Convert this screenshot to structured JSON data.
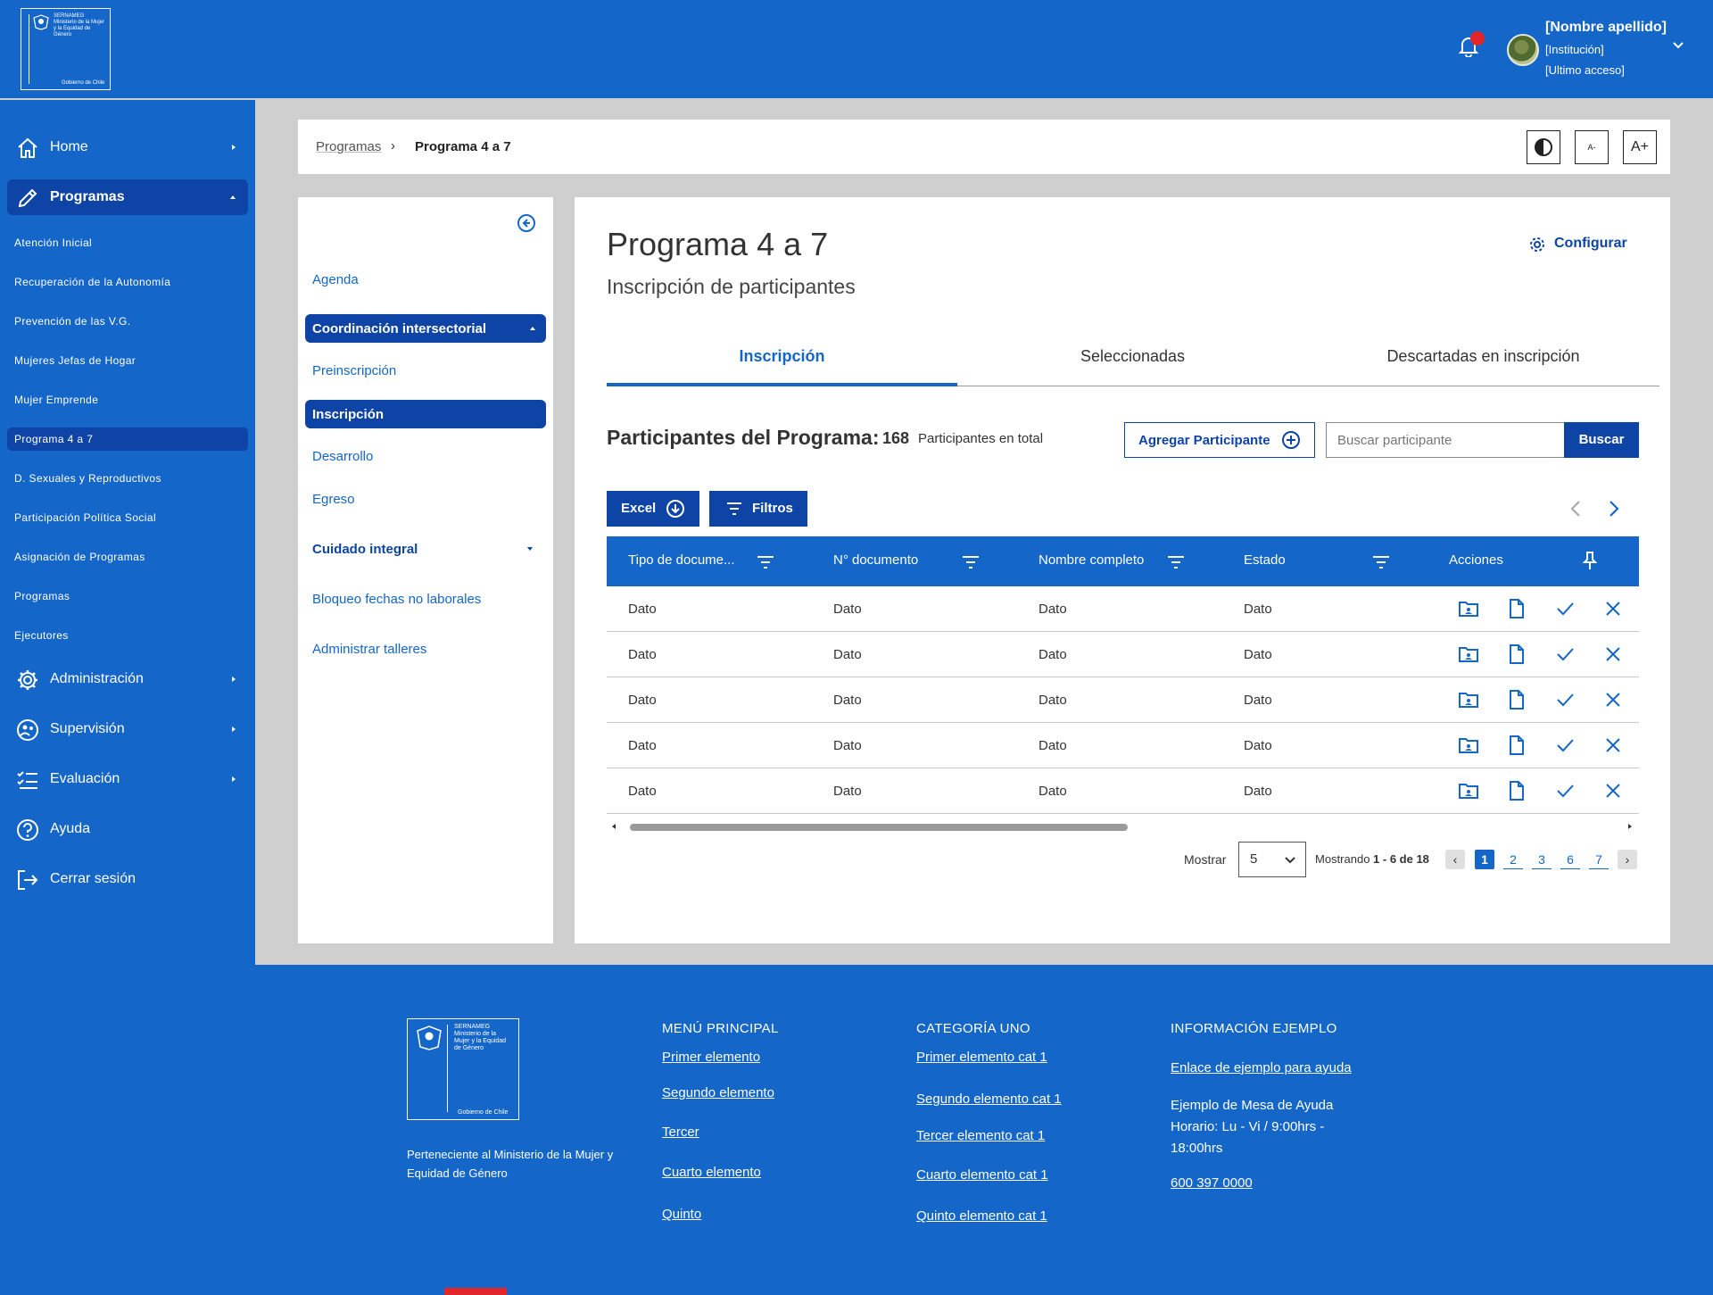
{
  "header": {
    "logo": {
      "line1": "SERNAMEG",
      "line2": "Ministerio de la Mujer y la Equidad de Género",
      "gob": "Gobierno de Chile"
    },
    "user": {
      "name": "[Nombre apellido]",
      "institution": "[Institución]",
      "last_access": "[Ultimo acceso]"
    }
  },
  "sidebar": {
    "home": "Home",
    "programas": "Programas",
    "sub_items": [
      "Atención Inicial",
      "Recuperación de la Autonomía",
      "Prevención de las V.G.",
      "Mujeres Jefas de Hogar",
      "Mujer Emprende",
      "Programa 4 a 7",
      "D. Sexuales y Reproductivos",
      "Participación Política Social",
      "Asignación de Programas",
      "Programas",
      "Ejecutores"
    ],
    "administracion": "Administración",
    "supervision": "Supervisión",
    "evaluacion": "Evaluación",
    "ayuda": "Ayuda",
    "cerrar": "Cerrar sesión"
  },
  "breadcrumb": {
    "parent": "Programas",
    "current": "Programa 4 a 7"
  },
  "toolbar": {
    "font_smaller": "A-",
    "font_larger": "A+"
  },
  "left_menu": {
    "agenda": "Agenda",
    "coordinacion": "Coordinación intersectorial",
    "preinscripcion": "Preinscripción",
    "inscripcion": "Inscripción",
    "desarrollo": "Desarrollo",
    "egreso": "Egreso",
    "cuidado": "Cuidado integral",
    "bloqueo": "Bloqueo fechas no laborales",
    "talleres": "Administrar talleres"
  },
  "main": {
    "title": "Programa 4 a 7",
    "subtitle": "Inscripción de participantes",
    "configurar": "Configurar",
    "tabs": [
      "Inscripción",
      "Seleccionadas",
      "Descartadas en inscripción"
    ],
    "participants_label": "Participantes del Programa:",
    "participants_count": "168",
    "participants_total": "Participantes en total",
    "add_button": "Agregar Participante",
    "search_placeholder": "Buscar participante",
    "search_button": "Buscar",
    "excel_button": "Excel",
    "filters_button": "Filtros"
  },
  "table": {
    "headers": [
      "Tipo de docume...",
      "N° documento",
      "Nombre completo",
      "Estado",
      "Acciones"
    ],
    "rows": [
      [
        "Dato",
        "Dato",
        "Dato",
        "Dato"
      ],
      [
        "Dato",
        "Dato",
        "Dato",
        "Dato"
      ],
      [
        "Dato",
        "Dato",
        "Dato",
        "Dato"
      ],
      [
        "Dato",
        "Dato",
        "Dato",
        "Dato"
      ],
      [
        "Dato",
        "Dato",
        "Dato",
        "Dato"
      ]
    ]
  },
  "pagination": {
    "show_label": "Mostrar",
    "page_size": "5",
    "showing_prefix": "Mostrando",
    "showing_range": "1 - 6 de 18",
    "pages": [
      "1",
      "2",
      "3",
      "6",
      "7"
    ],
    "current_page": "1"
  },
  "footer": {
    "logo": {
      "line1": "SERNAMEG",
      "line2": "Ministerio de la Mujer y la Equidad de Género",
      "gob": "Gobierno de Chile"
    },
    "description": "Perteneciente al Ministerio de la Mujer y Equidad de Género",
    "col1": {
      "title": "MENÚ PRINCIPAL",
      "links": [
        "Primer elemento",
        "Segundo elemento",
        "Tercer",
        "Cuarto elemento",
        "Quinto"
      ]
    },
    "col2": {
      "title": "CATEGORÍA UNO",
      "links": [
        "Primer elemento cat 1",
        "Segundo elemento cat 1",
        "Tercer elemento cat 1",
        "Cuarto elemento cat 1",
        "Quinto elemento cat 1"
      ]
    },
    "col3": {
      "title": "INFORMACIÓN EJEMPLO",
      "help_link": "Enlace de ejemplo para ayuda",
      "help_desk": "Ejemplo de Mesa de Ayuda",
      "hours": "Horario: Lu - Vi / 9:00hrs - 18:00hrs",
      "phone": "600 397 0000"
    }
  },
  "colors": {
    "primary": "#1466c8",
    "dark": "#0e44a5",
    "notification": "#e3262a"
  }
}
